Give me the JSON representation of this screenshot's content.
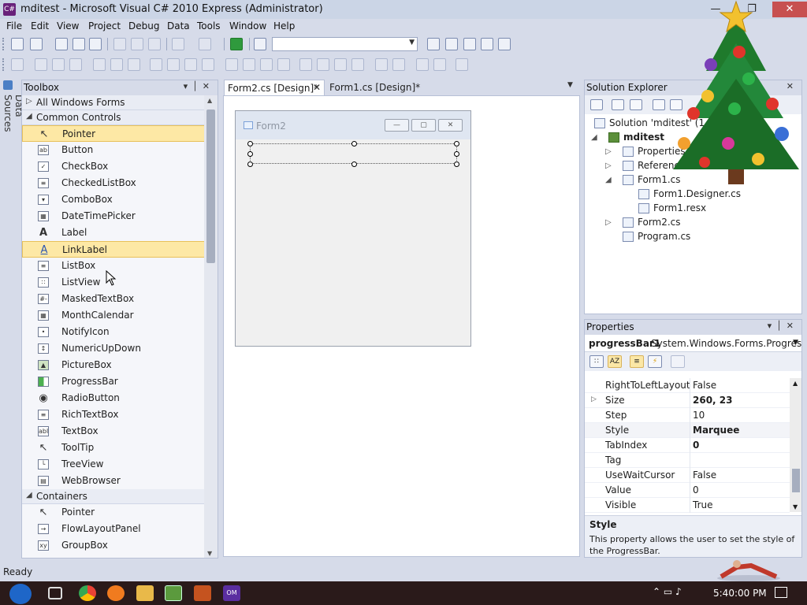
{
  "window": {
    "title": "mditest - Microsoft Visual C# 2010 Express (Administrator)"
  },
  "menu": [
    "File",
    "Edit",
    "View",
    "Project",
    "Debug",
    "Data",
    "Tools",
    "Window",
    "Help"
  ],
  "side_tab": {
    "label": "Data Sources"
  },
  "toolbox": {
    "title": "Toolbox",
    "groups": [
      {
        "label": "All Windows Forms",
        "expanded": false
      },
      {
        "label": "Common Controls",
        "expanded": true
      },
      {
        "label": "Containers",
        "expanded": true
      }
    ],
    "common_controls": [
      {
        "label": "Pointer",
        "icon": "pointer-icon",
        "selected": true
      },
      {
        "label": "Button",
        "icon": "button-icon",
        "selected": false
      },
      {
        "label": "CheckBox",
        "icon": "checkbox-icon",
        "selected": false
      },
      {
        "label": "CheckedListBox",
        "icon": "checkedlistbox-icon",
        "selected": false
      },
      {
        "label": "ComboBox",
        "icon": "combobox-icon",
        "selected": false
      },
      {
        "label": "DateTimePicker",
        "icon": "datetimepicker-icon",
        "selected": false
      },
      {
        "label": "Label",
        "icon": "label-icon",
        "selected": false
      },
      {
        "label": "LinkLabel",
        "icon": "linklabel-icon",
        "selected": true
      },
      {
        "label": "ListBox",
        "icon": "listbox-icon",
        "selected": false
      },
      {
        "label": "ListView",
        "icon": "listview-icon",
        "selected": false
      },
      {
        "label": "MaskedTextBox",
        "icon": "maskedtextbox-icon",
        "selected": false
      },
      {
        "label": "MonthCalendar",
        "icon": "monthcalendar-icon",
        "selected": false
      },
      {
        "label": "NotifyIcon",
        "icon": "notifyicon-icon",
        "selected": false
      },
      {
        "label": "NumericUpDown",
        "icon": "numericupdown-icon",
        "selected": false
      },
      {
        "label": "PictureBox",
        "icon": "picturebox-icon",
        "selected": false
      },
      {
        "label": "ProgressBar",
        "icon": "progressbar-icon",
        "selected": false
      },
      {
        "label": "RadioButton",
        "icon": "radiobutton-icon",
        "selected": false
      },
      {
        "label": "RichTextBox",
        "icon": "richtextbox-icon",
        "selected": false
      },
      {
        "label": "TextBox",
        "icon": "textbox-icon",
        "selected": false
      },
      {
        "label": "ToolTip",
        "icon": "tooltip-icon",
        "selected": false
      },
      {
        "label": "TreeView",
        "icon": "treeview-icon",
        "selected": false
      },
      {
        "label": "WebBrowser",
        "icon": "webbrowser-icon",
        "selected": false
      }
    ],
    "containers": [
      {
        "label": "Pointer",
        "icon": "pointer-icon"
      },
      {
        "label": "FlowLayoutPanel",
        "icon": "flowlayoutpanel-icon"
      },
      {
        "label": "GroupBox",
        "icon": "groupbox-icon"
      }
    ]
  },
  "doc_tabs": [
    {
      "label": "Form2.cs [Design]*",
      "active": true
    },
    {
      "label": "Form1.cs [Design]*",
      "active": false
    }
  ],
  "designer": {
    "form_title": "Form2"
  },
  "solution_explorer": {
    "title": "Solution Explorer",
    "nodes": [
      {
        "label": "Solution 'mditest' (1"
      },
      {
        "label": "mditest"
      },
      {
        "label": "Properties"
      },
      {
        "label": "References"
      },
      {
        "label": "Form1.cs"
      },
      {
        "label": "Form1.Designer.cs"
      },
      {
        "label": "Form1.resx"
      },
      {
        "label": "Form2.cs"
      },
      {
        "label": "Program.cs"
      }
    ]
  },
  "properties": {
    "title": "Properties",
    "object_name": "progressBar1",
    "object_type": "System.Windows.Forms.Progress",
    "rows": [
      {
        "name": "RightToLeftLayout",
        "value": "False",
        "bold": false,
        "expandable": false
      },
      {
        "name": "Size",
        "value": "260, 23",
        "bold": true,
        "expandable": true
      },
      {
        "name": "Step",
        "value": "10",
        "bold": false,
        "expandable": false
      },
      {
        "name": "Style",
        "value": "Marquee",
        "bold": true,
        "expandable": false
      },
      {
        "name": "TabIndex",
        "value": "0",
        "bold": true,
        "expandable": false
      },
      {
        "name": "Tag",
        "value": "",
        "bold": false,
        "expandable": false
      },
      {
        "name": "UseWaitCursor",
        "value": "False",
        "bold": false,
        "expandable": false
      },
      {
        "name": "Value",
        "value": "0",
        "bold": false,
        "expandable": false
      },
      {
        "name": "Visible",
        "value": "True",
        "bold": false,
        "expandable": false
      }
    ],
    "description_title": "Style",
    "description_text": "This property allows the user to set the style of the ProgressBar."
  },
  "status": {
    "text": "Ready"
  },
  "taskbar": {
    "clock": "5:40:00 PM",
    "apps": [
      "task-view-icon",
      "chrome-icon",
      "firefox-icon",
      "file-explorer-icon",
      "visual-csharp-icon",
      "app-icon",
      "om-app-icon"
    ]
  },
  "colors": {
    "accent": "#68217a",
    "selection": "#fde8a5",
    "chrome": "#d6dbe9",
    "close": "#c75050"
  }
}
